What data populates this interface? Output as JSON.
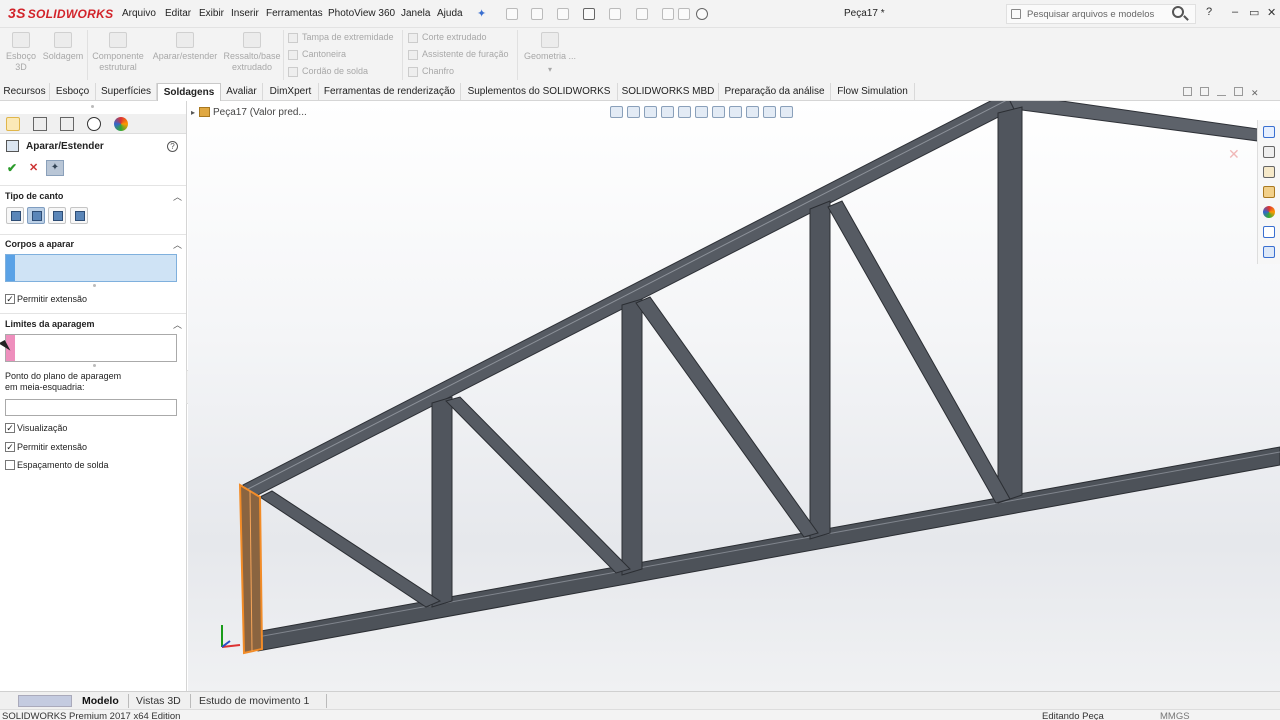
{
  "app": {
    "logo_text": "SOLIDWORKS",
    "logo_mark": "3S",
    "document_title": "Peça17 *"
  },
  "menu": [
    "Arquivo",
    "Editar",
    "Exibir",
    "Inserir",
    "Ferramentas",
    "PhotoView 360",
    "Janela",
    "Ajuda"
  ],
  "search": {
    "placeholder": "Pesquisar arquivos e modelos"
  },
  "window_controls": {
    "help": "?",
    "minimize": "–",
    "restore": "▭",
    "close": "✕"
  },
  "command_manager": {
    "big_buttons": [
      {
        "label": "Esboço\n3D",
        "icon": "3d-sketch-icon"
      },
      {
        "label": "Soldagem",
        "icon": "weldment-icon"
      },
      {
        "label": "Componente\nestrutural",
        "icon": "structural-member-icon"
      },
      {
        "label": "Aparar/estender",
        "icon": "trim-extend-icon"
      },
      {
        "label": "Ressalto/base\nextrudado",
        "icon": "extruded-boss-icon"
      }
    ],
    "small_buttons_col1": [
      "Tampa de extremidade",
      "Cantoneira",
      "Cordão de solda"
    ],
    "small_buttons_col2": [
      "Corte extrudado",
      "Assistente de furação",
      "Chanfro"
    ],
    "geometry_button": "Geometria ..."
  },
  "tabs": [
    {
      "label": "Recursos",
      "active": false
    },
    {
      "label": "Esboço",
      "active": false
    },
    {
      "label": "Superfícies",
      "active": false
    },
    {
      "label": "Soldagens",
      "active": true
    },
    {
      "label": "Avaliar",
      "active": false
    },
    {
      "label": "DimXpert",
      "active": false
    },
    {
      "label": "Ferramentas de renderização",
      "active": false
    },
    {
      "label": "Suplementos do SOLIDWORKS",
      "active": false
    },
    {
      "label": "SOLIDWORKS MBD",
      "active": false
    },
    {
      "label": "Preparação da análise",
      "active": false
    },
    {
      "label": "Flow Simulation",
      "active": false
    }
  ],
  "property_manager": {
    "title": "Aparar/Estender",
    "help": "?",
    "ok": "✔",
    "cancel": "✕",
    "sections": {
      "corner_type": {
        "title": "Tipo de canto",
        "selected_index": 1
      },
      "bodies_to_trim": {
        "title": "Corpos a aparar",
        "allow_extension": "Permitir extensão",
        "allow_extension_checked": true
      },
      "trim_limits": {
        "title": "Limites da aparagem",
        "miter_point_label": "Ponto do plano de aparagem\nem meia-esquadria:",
        "preview": "Visualização",
        "preview_checked": true,
        "allow_extension": "Permitir extensão",
        "allow_extension_checked": true,
        "weld_gap": "Espaçamento de solda",
        "weld_gap_checked": false
      }
    }
  },
  "viewport": {
    "tree_root": "Peça17  (Valor pred...",
    "accent_selected": "#f28c28",
    "beam_color": "#4b5058"
  },
  "bottom_tabs": [
    {
      "label": "Modelo",
      "active": true
    },
    {
      "label": "Vistas 3D",
      "active": false
    },
    {
      "label": "Estudo de movimento 1",
      "active": false
    }
  ],
  "status": {
    "left": "SOLIDWORKS Premium 2017 x64 Edition",
    "right": "Editando Peça",
    "units": "MMGS"
  }
}
